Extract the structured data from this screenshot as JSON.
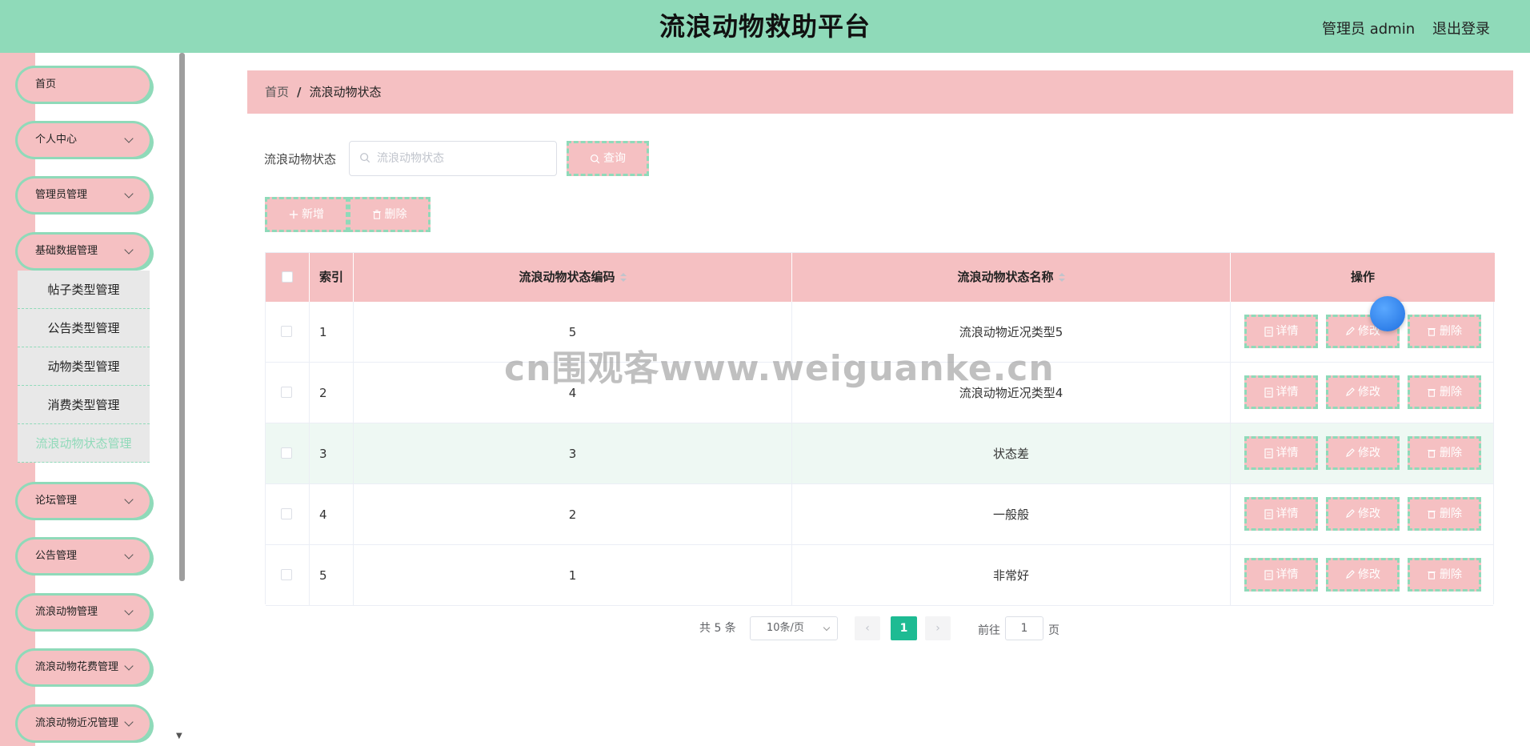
{
  "header": {
    "title": "流浪动物救助平台",
    "user": "管理员 admin",
    "logout": "退出登录"
  },
  "sidebar": {
    "items": [
      {
        "label": "首页",
        "has_chevron": false
      },
      {
        "label": "个人中心",
        "has_chevron": true
      },
      {
        "label": "管理员管理",
        "has_chevron": true
      },
      {
        "label": "基础数据管理",
        "has_chevron": true
      },
      {
        "label": "论坛管理",
        "has_chevron": true
      },
      {
        "label": "公告管理",
        "has_chevron": true
      },
      {
        "label": "流浪动物管理",
        "has_chevron": true
      },
      {
        "label": "流浪动物花费管理",
        "has_chevron": true
      },
      {
        "label": "流浪动物近况管理",
        "has_chevron": true
      }
    ],
    "submenu": [
      {
        "label": "帖子类型管理",
        "active": false
      },
      {
        "label": "公告类型管理",
        "active": false
      },
      {
        "label": "动物类型管理",
        "active": false
      },
      {
        "label": "消费类型管理",
        "active": false
      },
      {
        "label": "流浪动物状态管理",
        "active": true
      }
    ]
  },
  "breadcrumb": {
    "home": "首页",
    "separator": "/",
    "current": "流浪动物状态"
  },
  "search": {
    "label": "流浪动物状态",
    "placeholder": "流浪动物状态",
    "value": "",
    "button": "查询"
  },
  "toolbar": {
    "add": "新增",
    "delete": "删除"
  },
  "table": {
    "headers": {
      "index": "索引",
      "code": "流浪动物状态编码",
      "name": "流浪动物状态名称",
      "ops": "操作"
    },
    "rows": [
      {
        "index": "1",
        "code": "5",
        "name": "流浪动物近况类型5"
      },
      {
        "index": "2",
        "code": "4",
        "name": "流浪动物近况类型4"
      },
      {
        "index": "3",
        "code": "3",
        "name": "状态差"
      },
      {
        "index": "4",
        "code": "2",
        "name": "一般般"
      },
      {
        "index": "5",
        "code": "1",
        "name": "非常好"
      }
    ],
    "actions": {
      "detail": "详情",
      "edit": "修改",
      "delete": "删除"
    }
  },
  "pagination": {
    "total": "共 5 条",
    "page_size": "10条/页",
    "current": "1",
    "goto": "前往",
    "goto_value": "1",
    "page_suffix": "页"
  },
  "watermark": "cn围观客www.weiguanke.cn",
  "colors": {
    "primary_green": "#8fdab9",
    "pink": "#f5c0c2",
    "active_page": "#1ebb93"
  }
}
